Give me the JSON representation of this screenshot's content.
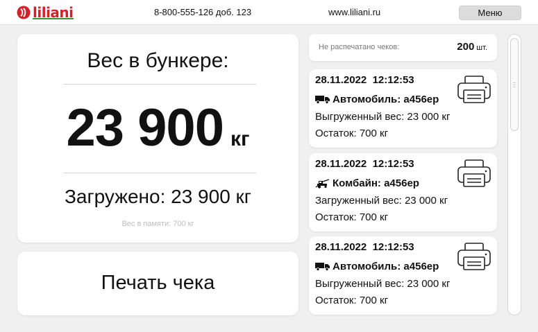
{
  "header": {
    "logo_text": "liliani",
    "phone": "8-800-555-126 доб. 123",
    "website": "www.liliani.ru",
    "menu_label": "Меню"
  },
  "weight_panel": {
    "title": "Вес в бункере:",
    "value": "23 900",
    "unit": "кг",
    "loaded_text": "Загружено: 23 900 кг",
    "memory_text": "Вес в памяти: 700 кг"
  },
  "print_button": {
    "label": "Печать чека"
  },
  "unprinted": {
    "label": "Не распечатано чеков:",
    "count": "200",
    "unit": "шт."
  },
  "receipts": [
    {
      "datetime": "28.11.2022  12:12:53",
      "vehicle_icon": "truck-icon",
      "vehicle": "Автомобиль: а456ер",
      "weight_text": "Выгруженный вес: 23 000 кг",
      "remainder_text": "Остаток: 700 кг"
    },
    {
      "datetime": "28.11.2022  12:12:53",
      "vehicle_icon": "combine-harvester-icon",
      "vehicle": "Комбайн: а456ер",
      "weight_text": "Загруженный вес: 23 000 кг",
      "remainder_text": "Остаток: 700 кг"
    },
    {
      "datetime": "28.11.2022  12:12:53",
      "vehicle_icon": "truck-icon",
      "vehicle": "Автомобиль: а456ер",
      "weight_text": "Выгруженный вес: 23 000 кг",
      "remainder_text": "Остаток: 700 кг"
    }
  ],
  "colors": {
    "brand_red": "#d3202a",
    "brand_green": "#2e9b3a",
    "background": "#f0f0f0",
    "card": "#ffffff"
  }
}
